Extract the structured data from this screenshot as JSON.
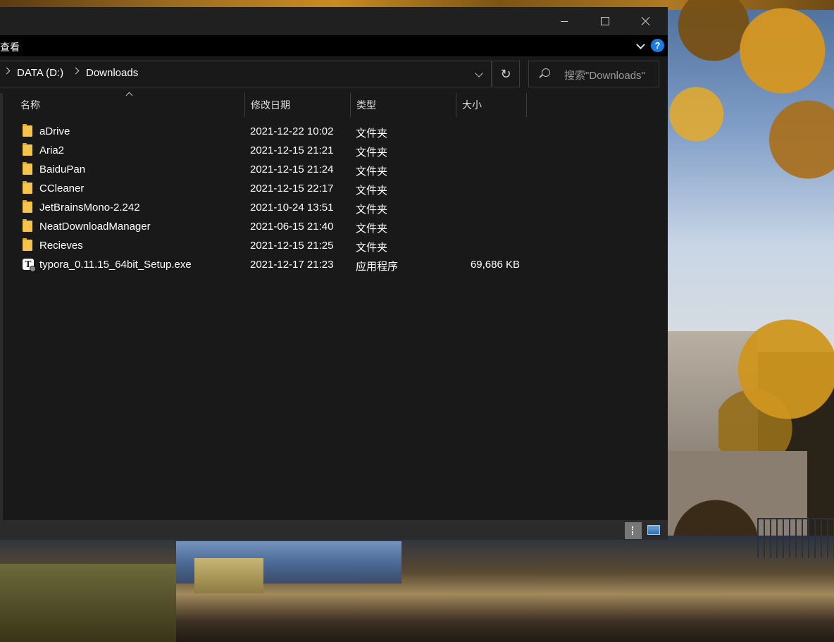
{
  "window": {
    "ribbon_tab": "查看"
  },
  "address": {
    "breadcrumb": [
      "DATA (D:)",
      "Downloads"
    ],
    "search_placeholder": "搜索\"Downloads\""
  },
  "columns": {
    "name": "名称",
    "date": "修改日期",
    "type": "类型",
    "size": "大小"
  },
  "files": [
    {
      "name": "aDrive",
      "date": "2021-12-22 10:02",
      "type": "文件夹",
      "size": "",
      "icon": "folder-icon"
    },
    {
      "name": "Aria2",
      "date": "2021-12-15 21:21",
      "type": "文件夹",
      "size": "",
      "icon": "folder-icon"
    },
    {
      "name": "BaiduPan",
      "date": "2021-12-15 21:24",
      "type": "文件夹",
      "size": "",
      "icon": "folder-icon"
    },
    {
      "name": "CCleaner",
      "date": "2021-12-15 22:17",
      "type": "文件夹",
      "size": "",
      "icon": "folder-icon"
    },
    {
      "name": "JetBrainsMono-2.242",
      "date": "2021-10-24 13:51",
      "type": "文件夹",
      "size": "",
      "icon": "folder-icon"
    },
    {
      "name": "NeatDownloadManager",
      "date": "2021-06-15 21:40",
      "type": "文件夹",
      "size": "",
      "icon": "folder-icon"
    },
    {
      "name": "Recieves",
      "date": "2021-12-15 21:25",
      "type": "文件夹",
      "size": "",
      "icon": "folder-icon"
    },
    {
      "name": "typora_0.11.15_64bit_Setup.exe",
      "date": "2021-12-17 21:23",
      "type": "应用程序",
      "size": "69,686 KB",
      "icon": "typora-app-icon",
      "icon_glyph": "T"
    }
  ],
  "colors": {
    "window_bg": "#191919",
    "titlebar_bg": "#202020",
    "ribbon_bg": "#000000",
    "folder": "#f4c44e",
    "help_accent": "#1a7ce0"
  }
}
